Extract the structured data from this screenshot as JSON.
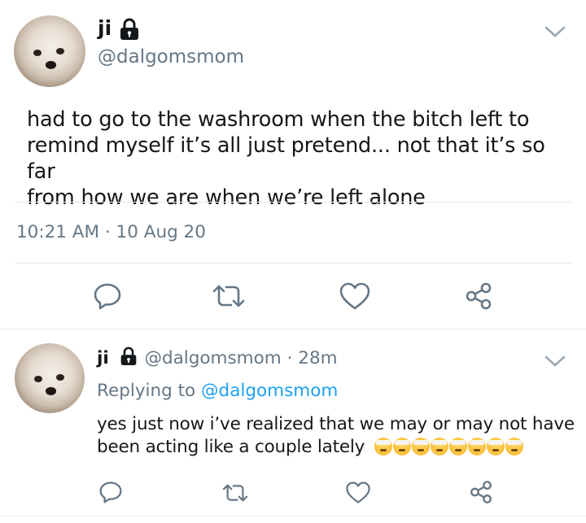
{
  "main_tweet": {
    "display_name": "ji",
    "handle": "@dalgomsmom",
    "text_lines": [
      "had to go to the washroom when the bitch left to",
      "remind myself it’s all just pretend... not that it’s so far",
      "from how we are when we’re left alone"
    ],
    "timestamp": "10:21 AM · 10 Aug 20"
  },
  "reply_tweet": {
    "display_name": "ji",
    "handle": "@dalgomsmom",
    "separator": "·",
    "age": "28m",
    "replying_prefix": "Replying to ",
    "replying_to": "@dalgomsmom",
    "text_lines": [
      "yes just now i’ve realized that we may or may not have",
      "been acting like a couple lately"
    ],
    "emoji_name": "face-with-head-bandage",
    "emoji_count": 8
  },
  "icons": {
    "lock": "lock-icon",
    "chevron": "chevron-down-icon",
    "reply": "reply-icon",
    "retweet": "retweet-icon",
    "like": "heart-icon",
    "share": "share-icon"
  },
  "colors": {
    "text": "#14171a",
    "secondary": "#657786",
    "link": "#1da1f2",
    "divider": "#e1e8ed"
  }
}
